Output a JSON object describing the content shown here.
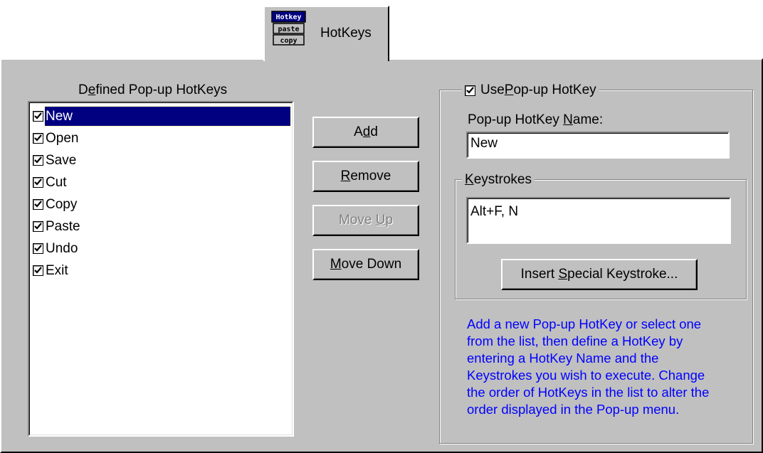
{
  "tab": {
    "label": "HotKeys",
    "icon": "hotkey-paste-copy-icon",
    "icon_lines": [
      "Hotkey",
      "paste",
      "copy"
    ]
  },
  "list_section": {
    "label_pre": "D",
    "label_mnemonic": "e",
    "label_post": "fined Pop-up HotKeys",
    "items": [
      {
        "label": "New",
        "checked": true,
        "selected": true
      },
      {
        "label": "Open",
        "checked": true,
        "selected": false
      },
      {
        "label": "Save",
        "checked": true,
        "selected": false
      },
      {
        "label": "Cut",
        "checked": true,
        "selected": false
      },
      {
        "label": "Copy",
        "checked": true,
        "selected": false
      },
      {
        "label": "Paste",
        "checked": true,
        "selected": false
      },
      {
        "label": "Undo",
        "checked": true,
        "selected": false
      },
      {
        "label": "Exit",
        "checked": true,
        "selected": false
      }
    ]
  },
  "buttons": {
    "add": {
      "pre": "A",
      "mn": "d",
      "post": "d"
    },
    "remove": {
      "pre": "",
      "mn": "R",
      "post": "emove"
    },
    "move_up": {
      "pre": "Move ",
      "mn": "U",
      "post": "p",
      "disabled": true
    },
    "move_down": {
      "pre": "",
      "mn": "M",
      "post": "ove Down"
    }
  },
  "use_popup": {
    "checked": true,
    "pre": "Use ",
    "mn": "P",
    "post": "op-up HotKey"
  },
  "name_field": {
    "label_pre": "Pop-up HotKey ",
    "label_mn": "N",
    "label_post": "ame:",
    "value": "New"
  },
  "keystrokes": {
    "legend_pre": "",
    "legend_mn": "K",
    "legend_post": "eystrokes",
    "value": "Alt+F, N",
    "insert_pre": "Insert ",
    "insert_mn": "S",
    "insert_post": "pecial Keystroke..."
  },
  "help_lines": [
    "Add a new Pop-up HotKey or select one",
    "from the list, then define a HotKey by",
    "entering a HotKey Name and the",
    "Keystrokes you wish to execute. Change",
    "the order of HotKeys in the list to alter the",
    "order displayed in the Pop-up menu."
  ],
  "colors": {
    "face": "#c0c0c0",
    "selection": "#000080",
    "help_text": "#0000ff",
    "disabled_text": "#808080"
  }
}
